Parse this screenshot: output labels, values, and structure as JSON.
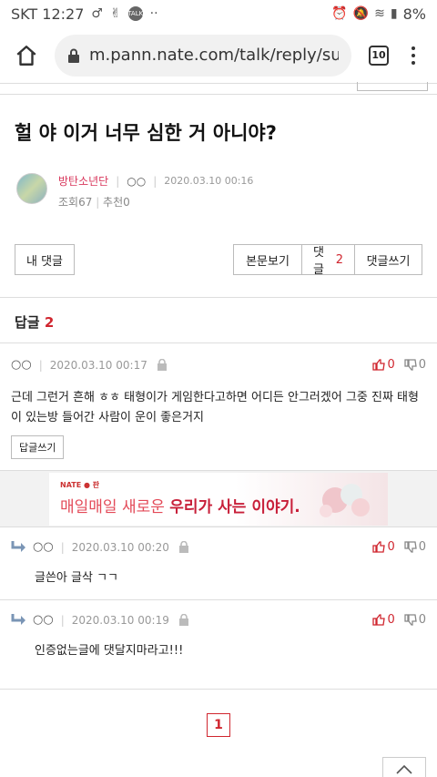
{
  "status_bar": {
    "carrier_time": "SKT 12:27",
    "talk": "TALK",
    "dots": "··",
    "battery": "8%"
  },
  "browser": {
    "url": "m.pann.nate.com/talk/reply/su",
    "tab_count": "10"
  },
  "post": {
    "title": "헐 야 이거 너무 심한 거 아니야?",
    "author": "방탄소년단",
    "author_id": "○○",
    "date": "2020.03.10 00:16",
    "views": "조회67",
    "recommends": "추천0"
  },
  "buttons": {
    "my_replies": "내 댓글",
    "view_post": "본문보기",
    "replies": "댓글",
    "replies_count": "2",
    "write_reply": "댓글쓰기"
  },
  "reply_section": {
    "label": "답글",
    "count": "2"
  },
  "comments": [
    {
      "author": "○○",
      "date": "2020.03.10 00:17",
      "up": "0",
      "down": "0",
      "body": "근데 그런거 흔해 ㅎㅎ 태형이가 게임한다고하면 어디든 안그러겠어 그중 진짜 태형이 있는방 들어간 사람이 운이 좋은거지",
      "reply_button": "답글쓰기"
    }
  ],
  "ad": {
    "brand": "NATE ● 판",
    "text_normal": "매일매일 새로운 ",
    "text_bold": "우리가 사는 이야기."
  },
  "subcomments": [
    {
      "author": "○○",
      "date": "2020.03.10 00:20",
      "up": "0",
      "down": "0",
      "body": "글쓴아 글삭 ㄱㄱ"
    },
    {
      "author": "○○",
      "date": "2020.03.10 00:19",
      "up": "0",
      "down": "0",
      "body": "인증없는글에 댓달지마라고!!!"
    }
  ],
  "pager": {
    "current": "1"
  },
  "colors": {
    "accent": "#d0262f",
    "nick": "#d8365b"
  }
}
